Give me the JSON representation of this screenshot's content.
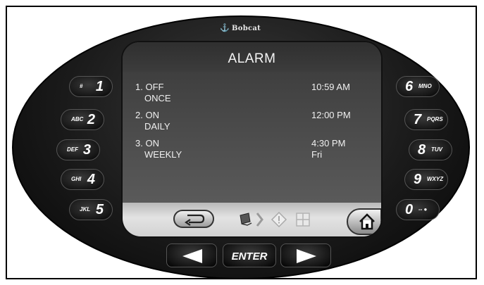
{
  "device": {
    "brand": "Bobcat"
  },
  "screen": {
    "title": "ALARM",
    "alarms": [
      {
        "number": "1.",
        "status": "OFF",
        "frequency": "ONCE",
        "time": "10:59 AM",
        "day": ""
      },
      {
        "number": "2.",
        "status": "ON",
        "frequency": "DAILY",
        "time": "12:00 PM",
        "day": ""
      },
      {
        "number": "3.",
        "status": "ON",
        "frequency": "WEEKLY",
        "time": "4:30 PM",
        "day": "Fri"
      }
    ],
    "footer_icons": [
      "back-arrow-icon",
      "monitor-icon",
      "chevron-right-icon",
      "warning-diamond-icon",
      "grid-icon",
      "home-icon"
    ]
  },
  "keypad": {
    "left": [
      {
        "letters": "#",
        "number": "1"
      },
      {
        "letters": "ABC",
        "number": "2"
      },
      {
        "letters": "DEF",
        "number": "3"
      },
      {
        "letters": "GHI",
        "number": "4"
      },
      {
        "letters": "JKL",
        "number": "5"
      }
    ],
    "right": [
      {
        "number": "6",
        "letters": "MNO"
      },
      {
        "number": "7",
        "letters": "PQRS"
      },
      {
        "number": "8",
        "letters": "TUV"
      },
      {
        "number": "9",
        "letters": "WXYZ"
      },
      {
        "number": "0",
        "letters": "-- ●"
      }
    ]
  },
  "nav": {
    "enter_label": "ENTER"
  }
}
